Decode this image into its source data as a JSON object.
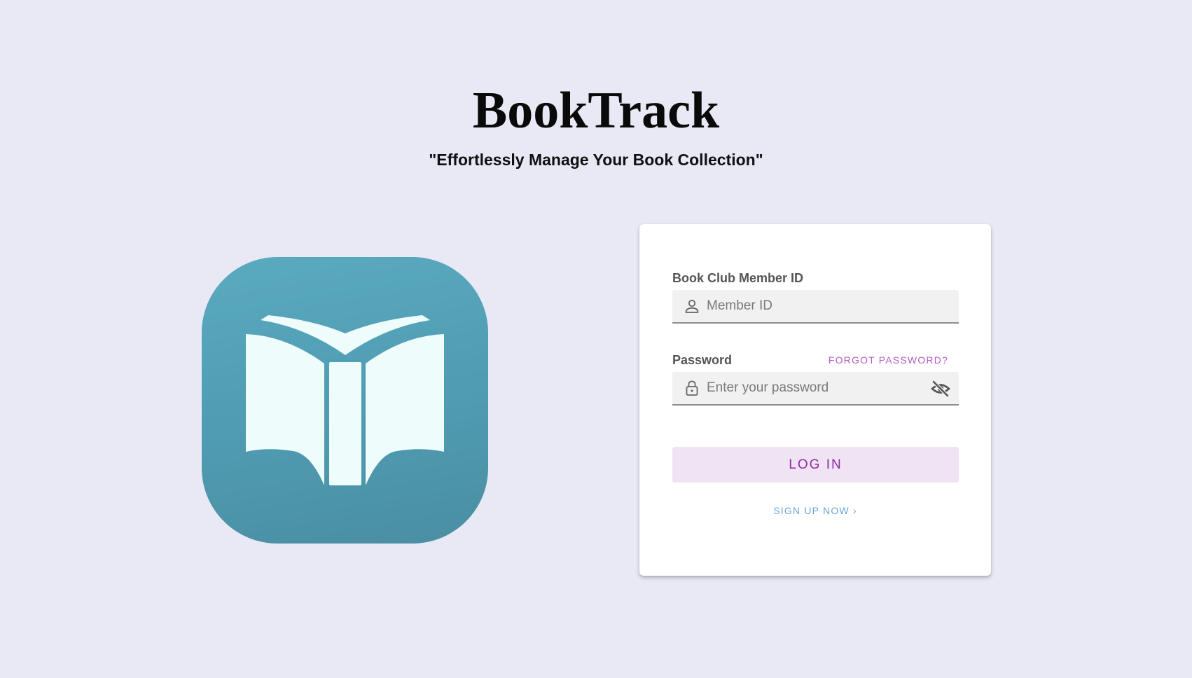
{
  "header": {
    "title": "BookTrack",
    "tagline": "\"Effortlessly Manage Your Book Collection\""
  },
  "logo": {
    "icon": "open-book-icon",
    "background_color": "#509db3",
    "book_color": "#eefcfc"
  },
  "login_form": {
    "member_id": {
      "label": "Book Club Member ID",
      "placeholder": "Member ID",
      "value": "",
      "icon": "user-icon"
    },
    "password": {
      "label": "Password",
      "placeholder": "Enter your password",
      "value": "",
      "icon": "lock-icon",
      "visibility_icon": "eye-off-icon"
    },
    "forgot_password_label": "FORGOT PASSWORD?",
    "login_button_label": "LOG IN",
    "signup_label": "SIGN UP NOW ›"
  },
  "colors": {
    "page_background": "#e9e9f5",
    "accent_purple": "#8e2aa3",
    "link_purple": "#b65bc6",
    "link_blue": "#69a5d6",
    "button_background": "#f0e3f3"
  }
}
